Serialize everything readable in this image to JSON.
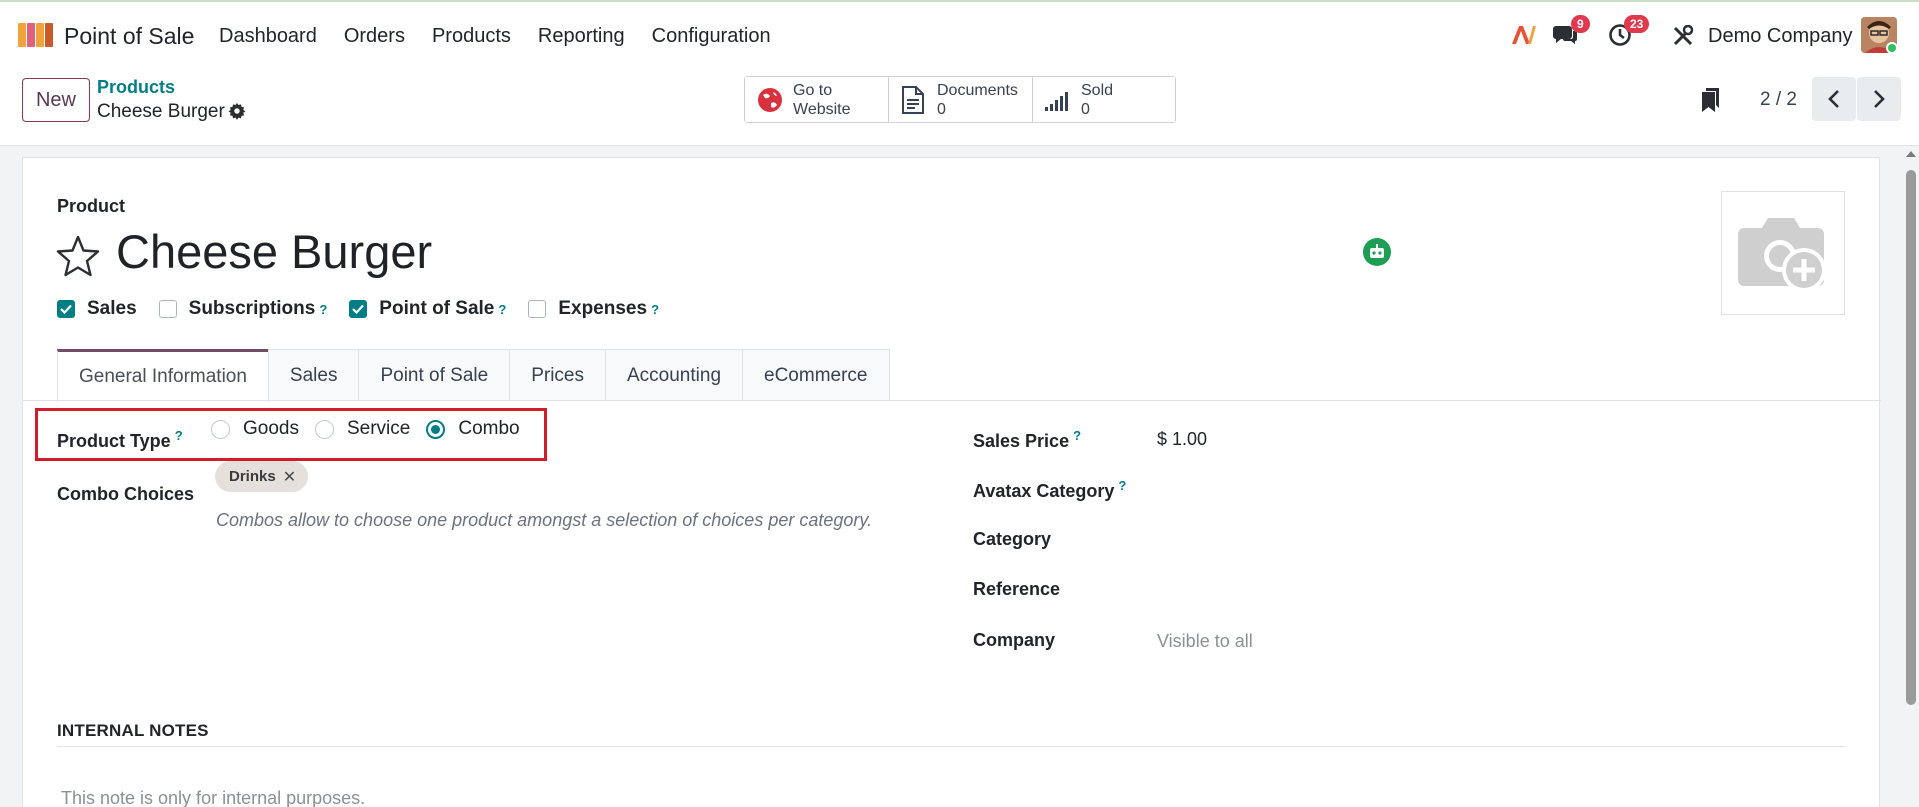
{
  "app": {
    "name": "Point of Sale"
  },
  "nav": {
    "items": [
      "Dashboard",
      "Orders",
      "Products",
      "Reporting",
      "Configuration"
    ]
  },
  "systray": {
    "messages_count": "9",
    "activities_count": "23",
    "company": "Demo Company"
  },
  "control": {
    "new_label": "New",
    "breadcrumb_parent": "Products",
    "breadcrumb_current": "Cheese Burger",
    "smart_buttons": {
      "website_line1": "Go to",
      "website_line2": "Website",
      "documents_label": "Documents",
      "documents_count": "0",
      "sold_label": "Sold",
      "sold_count": "0"
    },
    "pager": "2 / 2"
  },
  "form": {
    "product_label": "Product",
    "name": "Cheese Burger",
    "checkboxes": {
      "sales": {
        "label": "Sales",
        "checked": true
      },
      "subscriptions": {
        "label": "Subscriptions",
        "checked": false
      },
      "pos": {
        "label": "Point of Sale",
        "checked": true
      },
      "expenses": {
        "label": "Expenses",
        "checked": false
      }
    },
    "help_mark": "?",
    "tabs": [
      "General Information",
      "Sales",
      "Point of Sale",
      "Prices",
      "Accounting",
      "eCommerce"
    ],
    "active_tab": "General Information",
    "product_type": {
      "label": "Product Type",
      "options": [
        "Goods",
        "Service",
        "Combo"
      ],
      "selected": "Combo"
    },
    "combo_choices": {
      "label": "Combo Choices",
      "tags": [
        "Drinks"
      ],
      "remove_glyph": "✕",
      "hint": "Combos allow to choose one product amongst a selection of choices per category."
    },
    "right_fields": {
      "sales_price_label": "Sales Price",
      "sales_price_value": "$ 1.00",
      "avatax_label": "Avatax Category",
      "category_label": "Category",
      "reference_label": "Reference",
      "company_label": "Company",
      "company_value": "Visible to all"
    },
    "internal_notes": {
      "title": "INTERNAL NOTES",
      "placeholder": "This note is only for internal purposes."
    }
  },
  "colors": {
    "accent": "#017e84",
    "brand": "#714b67",
    "highlight": "#d11d2a",
    "badge": "#e0384c"
  }
}
